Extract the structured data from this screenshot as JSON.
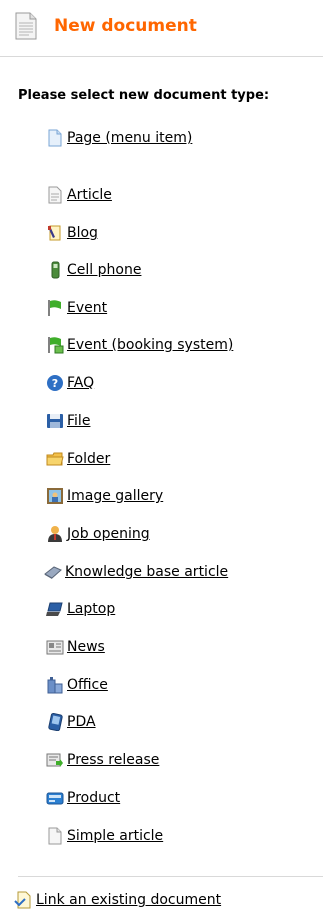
{
  "header": {
    "title": "New document",
    "icon": "document-icon"
  },
  "prompt": "Please select new document type:",
  "page_item": {
    "label": "Page (menu item)",
    "icon": "page-icon"
  },
  "types": [
    {
      "label": "Article",
      "icon": "article-icon"
    },
    {
      "label": "Blog",
      "icon": "blog-icon"
    },
    {
      "label": "Cell phone",
      "icon": "cell-phone-icon"
    },
    {
      "label": "Event",
      "icon": "event-flag-icon"
    },
    {
      "label": "Event (booking system)",
      "icon": "event-booking-icon"
    },
    {
      "label": "FAQ",
      "icon": "faq-question-icon"
    },
    {
      "label": "File",
      "icon": "file-floppy-icon"
    },
    {
      "label": "Folder",
      "icon": "folder-icon"
    },
    {
      "label": "Image gallery",
      "icon": "image-gallery-icon"
    },
    {
      "label": "Job opening",
      "icon": "job-opening-icon"
    },
    {
      "label": "Knowledge base article",
      "icon": "knowledge-base-icon"
    },
    {
      "label": "Laptop",
      "icon": "laptop-icon"
    },
    {
      "label": "News",
      "icon": "news-icon"
    },
    {
      "label": "Office",
      "icon": "office-building-icon"
    },
    {
      "label": "PDA",
      "icon": "pda-icon"
    },
    {
      "label": "Press release",
      "icon": "press-release-icon"
    },
    {
      "label": "Product",
      "icon": "product-icon"
    },
    {
      "label": "Simple article",
      "icon": "simple-article-icon"
    }
  ],
  "link_existing": {
    "label": "Link an existing document",
    "icon": "link-document-icon"
  },
  "colors": {
    "title": "#ff6600",
    "divider": "#d9d9d9"
  }
}
